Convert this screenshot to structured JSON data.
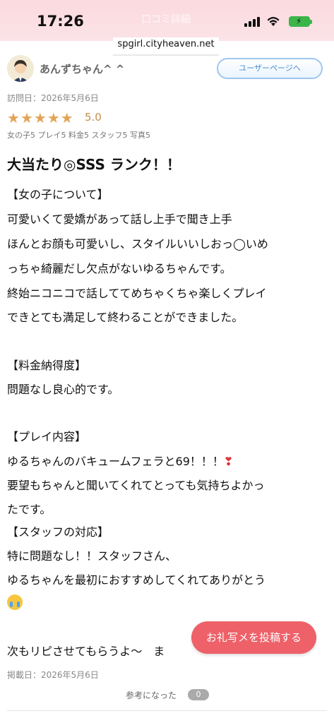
{
  "status_bar": {
    "time": "17:26",
    "header_title": "口コミ詳細"
  },
  "browser": {
    "url": "spgirl.cityheaven.net"
  },
  "reviewer": {
    "name": "あんずちゃん^ ^",
    "user_page_label": "ユーザーページへ"
  },
  "review": {
    "visit_date": "訪問日：2026年5月6日",
    "rating": "5.0",
    "star_count": 5,
    "sub_ratings": "女の子5 プレイ5 料金5 スタッフ5 写真5",
    "title": "大当たり◎SSS ランク！！",
    "lines": [
      "【女の子について】",
      "可愛いくて愛嬌があって話し上手で聞き上手",
      "ほんとお顔も可愛いし、スタイルいいしおっ◯いめ",
      "っちゃ綺麗だし欠点がないゆるちゃんです。",
      "終始ニコニコで話しててめちゃくちゃ楽しくプレイ",
      "できとても満足して終わることができました。",
      "【料金納得度】",
      "問題なし良心的です。",
      "【プレイ内容】",
      "ゆるちゃんのバキュームフェラと69！！！",
      "要望もちゃんと聞いてくれてとっても気持ちよかっ",
      "たです。",
      "【スタッフの対応】",
      "特に問題なし！！スタッフさん、",
      "ゆるちゃんを最初におすすめしてくれてありがとう",
      "次もリピさせてもらうよ〜　ま"
    ],
    "posted_date": "掲載日：2026年5月6日",
    "helpful_label": "参考になった",
    "helpful_count": "0"
  },
  "actions": {
    "post_photo_label": "お礼写メを投稿する"
  },
  "colors": {
    "header_bg": "#fbdfe4",
    "star": "#e2a455",
    "post_button": "#ee6169",
    "user_page_border": "#9ec7ef"
  },
  "icons": [
    "cellular-signal-icon",
    "wifi-icon",
    "battery-charging-icon",
    "avatar",
    "star-icon",
    "heart-emoji-icon",
    "crying-emoji-icon"
  ]
}
